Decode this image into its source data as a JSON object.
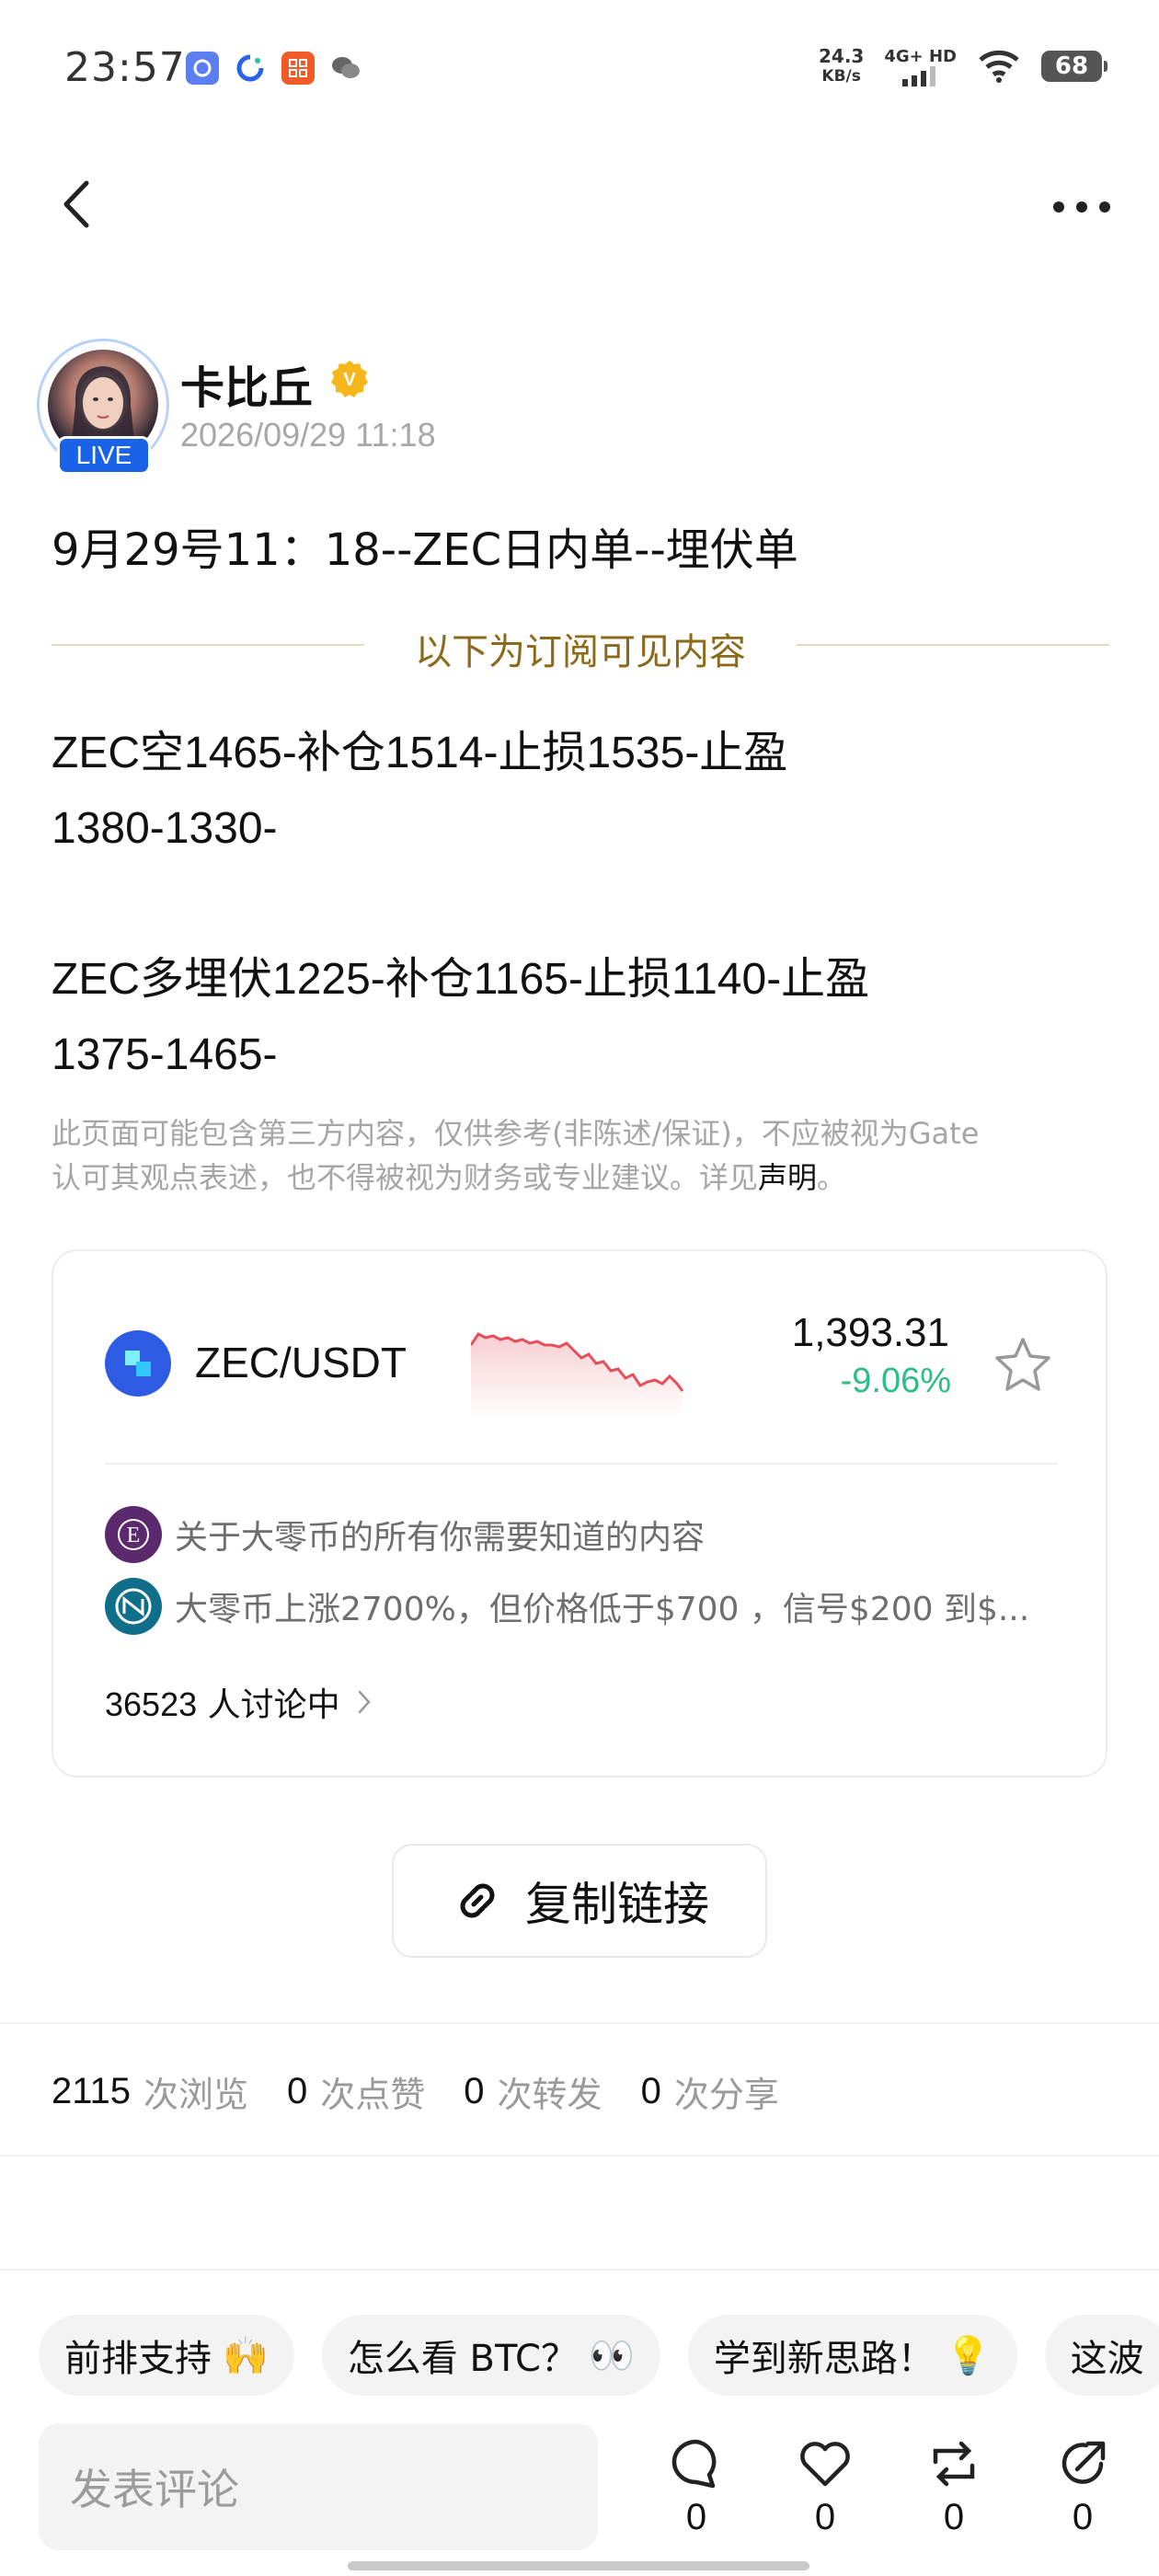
{
  "status_bar": {
    "time": "23:57",
    "net_speed": "24.3",
    "net_unit": "KB/s",
    "net_type": "4G+ HD",
    "battery": "68",
    "app_icons": [
      "browser-icon",
      "loop-app-icon",
      "grid-app-icon",
      "wechat-icon"
    ]
  },
  "nav": {
    "back_icon": "chevron-left-icon",
    "more_icon": "more-dots-icon"
  },
  "author": {
    "name": "卡比丘",
    "live_label": "LIVE",
    "time": "2026/09/29 11:18",
    "verified_mark": "V"
  },
  "post": {
    "title": "9月29号11：18--ZEC日内单--埋伏单",
    "subscribe_divider": "以下为订阅可见内容",
    "lines": [
      "ZEC空1465-补仓1514-止损1535-止盈",
      "1380-1330-",
      "ZEC多埋伏1225-补仓1165-止损1140-止盈",
      "1375-1465-"
    ],
    "disclaimer_line1": "此页面可能包含第三方内容，仅供参考(非陈述/保证)，不应被视为Gate",
    "disclaimer_line2": "认可其观点表述，也不得被视为财务或专业建议。详见",
    "disclaimer_link": "声明",
    "disclaimer_end": "。"
  },
  "token_card": {
    "pair": "ZEC/USDT",
    "price": "1,393.31",
    "change": "-9.06%",
    "change_color": "#2ebd85",
    "sparkline_color": "#e5505a",
    "news": [
      {
        "icon": "ecoinomist-logo-icon",
        "text": "关于大零币的所有你需要知道的内容"
      },
      {
        "icon": "news-source-logo-icon",
        "text": "大零币上涨2700%，但价格低于$700 ，信号$200 到$..."
      }
    ],
    "discuss_count": "36523",
    "discuss_label": "人讨论中"
  },
  "copy_link": {
    "label": "复制链接",
    "icon": "link-icon"
  },
  "stats": [
    {
      "num": "2115",
      "label": "次浏览"
    },
    {
      "num": "0",
      "label": "次点赞"
    },
    {
      "num": "0",
      "label": "次转发"
    },
    {
      "num": "0",
      "label": "次分享"
    }
  ],
  "quick_replies": [
    {
      "text": "前排支持",
      "emoji": "🙌"
    },
    {
      "text": "怎么看 BTC？",
      "emoji": "👀"
    },
    {
      "text": "学到新思路！",
      "emoji": "💡"
    },
    {
      "text": "这波",
      "emoji": ""
    }
  ],
  "comment": {
    "placeholder": "发表评论"
  },
  "actions": {
    "comment_count": "0",
    "like_count": "0",
    "repost_count": "0",
    "share_count": "0"
  }
}
